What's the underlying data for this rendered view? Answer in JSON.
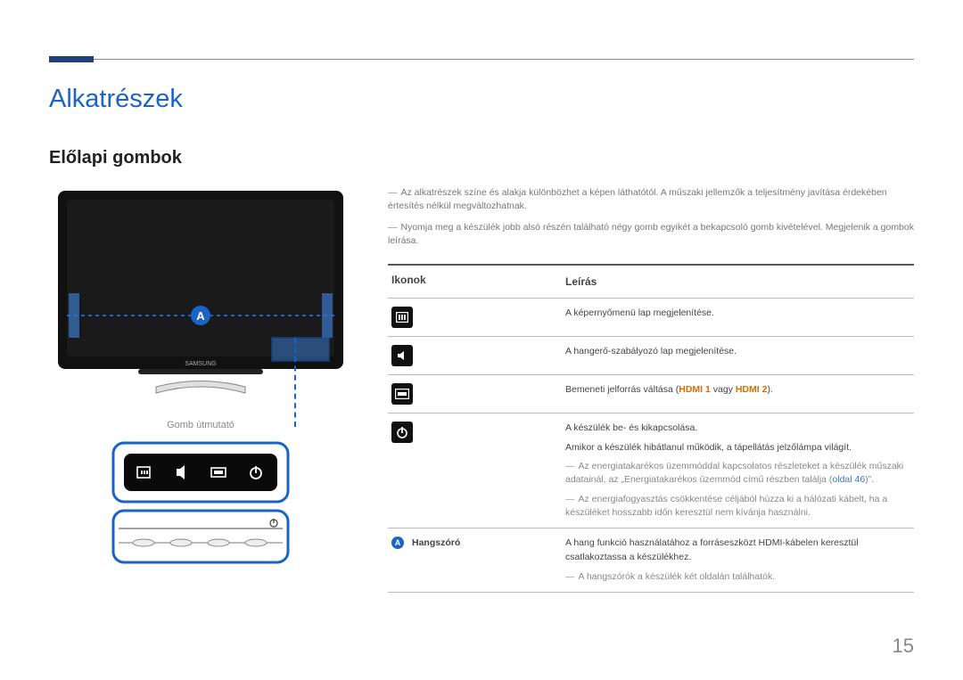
{
  "page": {
    "h1": "Alkatrészek",
    "h2": "Előlapi gombok",
    "page_number": "15"
  },
  "notes": {
    "n1": "Az alkatrészek színe és alakja különbözhet a képen láthatótól. A műszaki jellemzők a teljesítmény javítása érdekében értesítés nélkül megváltozhatnak.",
    "n2": "Nyomja meg a készülék jobb alsó részén található négy gomb egyikét a bekapcsoló gomb kivételével. Megjelenik a gombok leírása."
  },
  "caption": "Gomb útmutató",
  "table": {
    "col_icon": "Ikonok",
    "col_desc": "Leírás",
    "r1_desc": "A képernyőmenü lap megjelenítése.",
    "r2_desc": "A hangerő-szabályozó lap megjelenítése.",
    "r3_prefix": "Bemeneti jelforrás váltása (",
    "r3_h1": "HDMI 1",
    "r3_mid": " vagy ",
    "r3_h2": "HDMI 2",
    "r3_suffix": ").",
    "r4_l1": "A készülék be- és kikapcsolása.",
    "r4_l2": "Amikor a készülék hibátlanul működik, a tápellátás jelzőlámpa világít.",
    "r4_sub1a": "Az energiatakarékos üzemmóddal kapcsolatos részleteket a készülék műszaki adatainál, az „Energiatakarékos üzemmód című részben találja (",
    "r4_sub1_link": "oldal 46",
    "r4_sub1b": ")”.",
    "r4_sub2": "Az energiafogyasztás csökkentése céljából húzza ki a hálózati kábelt, ha a készüléket hosszabb időn keresztül nem kívánja használni.",
    "r5_label": "Hangszóró",
    "r5_desc": "A hang funkció használatához a forráseszközt HDMI-kábelen keresztül csatlakoztassa a készülékhez.",
    "r5_sub": "A hangszórók a készülék két oldalán találhatók."
  },
  "icons": {
    "menu": "menu-icon",
    "volume": "volume-icon",
    "source": "source-icon",
    "power": "power-icon",
    "badge_a": "A"
  }
}
